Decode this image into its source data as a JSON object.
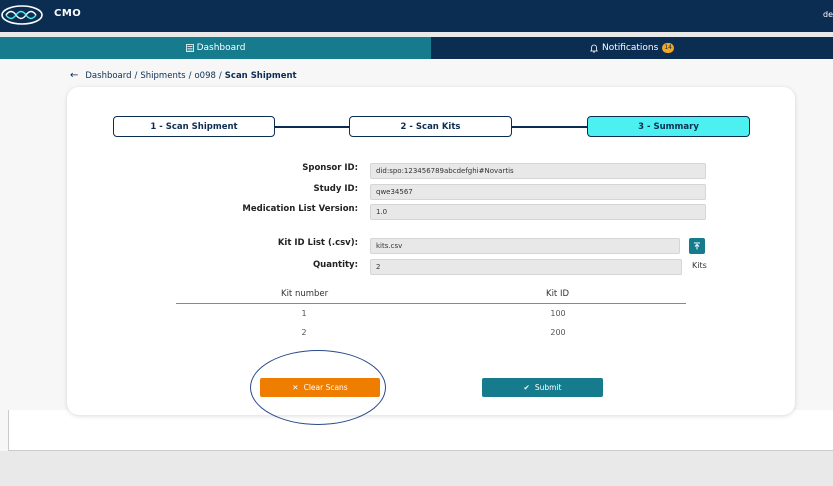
{
  "header": {
    "brand": "CMO",
    "user": "de"
  },
  "nav": {
    "dashboard_label": "Dashboard",
    "notifications_label": "Notifications",
    "notifications_count": "14"
  },
  "breadcrumb": {
    "items": [
      "Dashboard",
      "Shipments",
      "o098"
    ],
    "current": "Scan Shipment",
    "separator": "/"
  },
  "steps": [
    {
      "label": "1 - Scan Shipment",
      "active": false
    },
    {
      "label": "2 - Scan Kits",
      "active": false
    },
    {
      "label": "3 - Summary",
      "active": true
    }
  ],
  "form": {
    "sponsor_label": "Sponsor ID:",
    "sponsor_value": "did:spo:123456789abcdefghi#Novartis",
    "study_label": "Study ID:",
    "study_value": "qwe34567",
    "medlist_label": "Medication List Version:",
    "medlist_value": "1.0",
    "kitlist_label": "Kit ID List (.csv):",
    "kitlist_value": "kits.csv",
    "quantity_label": "Quantity:",
    "quantity_value": "2",
    "quantity_unit": "Kits"
  },
  "table": {
    "columns": [
      "Kit number",
      "Kit ID"
    ],
    "rows": [
      [
        "1",
        "100"
      ],
      [
        "2",
        "200"
      ]
    ]
  },
  "actions": {
    "clear_label": "Clear Scans",
    "submit_label": "Submit"
  },
  "colors": {
    "navy": "#0c2d52",
    "teal": "#167c8d",
    "active_step": "#4df0f0",
    "orange": "#ee7d00",
    "badge": "#f5a623"
  }
}
